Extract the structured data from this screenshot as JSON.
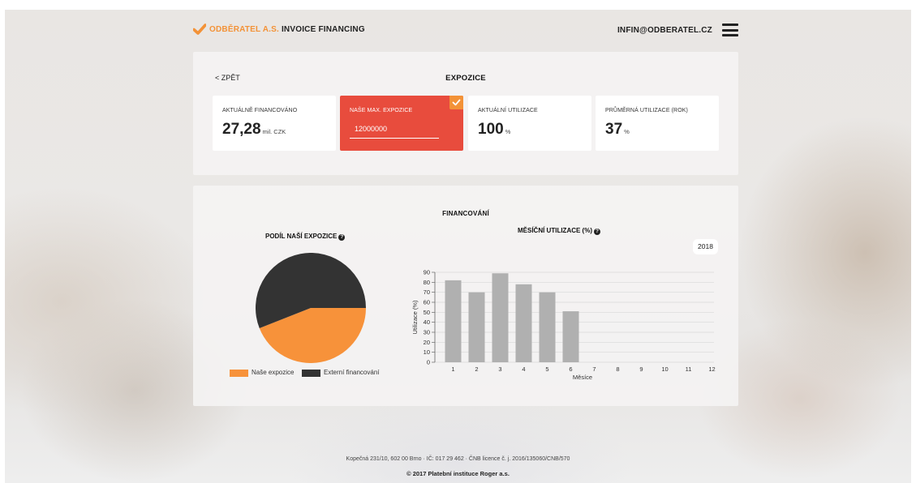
{
  "header": {
    "brand_name": "ODBĚRATEL A.S.",
    "brand_product": "INVOICE FINANCING",
    "email": "INFIN@ODBERATEL.CZ",
    "accent_color": "#f39237"
  },
  "exposure": {
    "back_label": "< ZPĚT",
    "title": "EXPOZICE",
    "cards": [
      {
        "label": "AKTUÁLNĚ FINANCOVÁNO",
        "value": "27,28",
        "unit": "mil. CZK"
      },
      {
        "label": "NAŠE MAX. EXPOZICE",
        "input_value": "12000000"
      },
      {
        "label": "AKTUÁLNÍ UTILIZACE",
        "value": "100",
        "unit": "%"
      },
      {
        "label": "PRŮMĚRNÁ UTILIZACE (ROK)",
        "value": "37",
        "unit": "%"
      }
    ],
    "active_card_color": "#e84c3d"
  },
  "financing": {
    "title": "FINANCOVÁNÍ",
    "pie_title": "PODÍL NAŠÍ EXPOZICE",
    "bar_title": "MĚSÍČNÍ UTILIZACE (%)",
    "year": "2018",
    "legend": [
      "Naše expozice",
      "Externí financování"
    ]
  },
  "chart_data": [
    {
      "type": "pie",
      "title": "PODÍL NAŠÍ EXPOZICE",
      "labels": [
        "Naše expozice",
        "Externí financování"
      ],
      "values": [
        44,
        56
      ],
      "colors": [
        "#f7923a",
        "#333333"
      ]
    },
    {
      "type": "bar",
      "title": "MĚSÍČNÍ UTILIZACE (%)",
      "xlabel": "Měsíce",
      "ylabel": "Utilizace (%)",
      "categories": [
        "1",
        "2",
        "3",
        "4",
        "5",
        "6",
        "7",
        "8",
        "9",
        "10",
        "11",
        "12"
      ],
      "values": [
        82,
        70,
        89,
        78,
        70,
        51,
        null,
        null,
        null,
        null,
        null,
        null
      ],
      "ylim": [
        0,
        90
      ],
      "yticks": [
        0,
        10,
        20,
        30,
        40,
        50,
        60,
        70,
        80,
        90
      ],
      "color": "#b0b0b0",
      "grid": true
    }
  ],
  "footer": {
    "address": "Kopečná 231/10, 602 00 Brno · IČ: 017 29 462 · ČNB licence č. j. 2016/135060/CNB/570",
    "copyright": "© 2017 Platební instituce Roger a.s."
  }
}
